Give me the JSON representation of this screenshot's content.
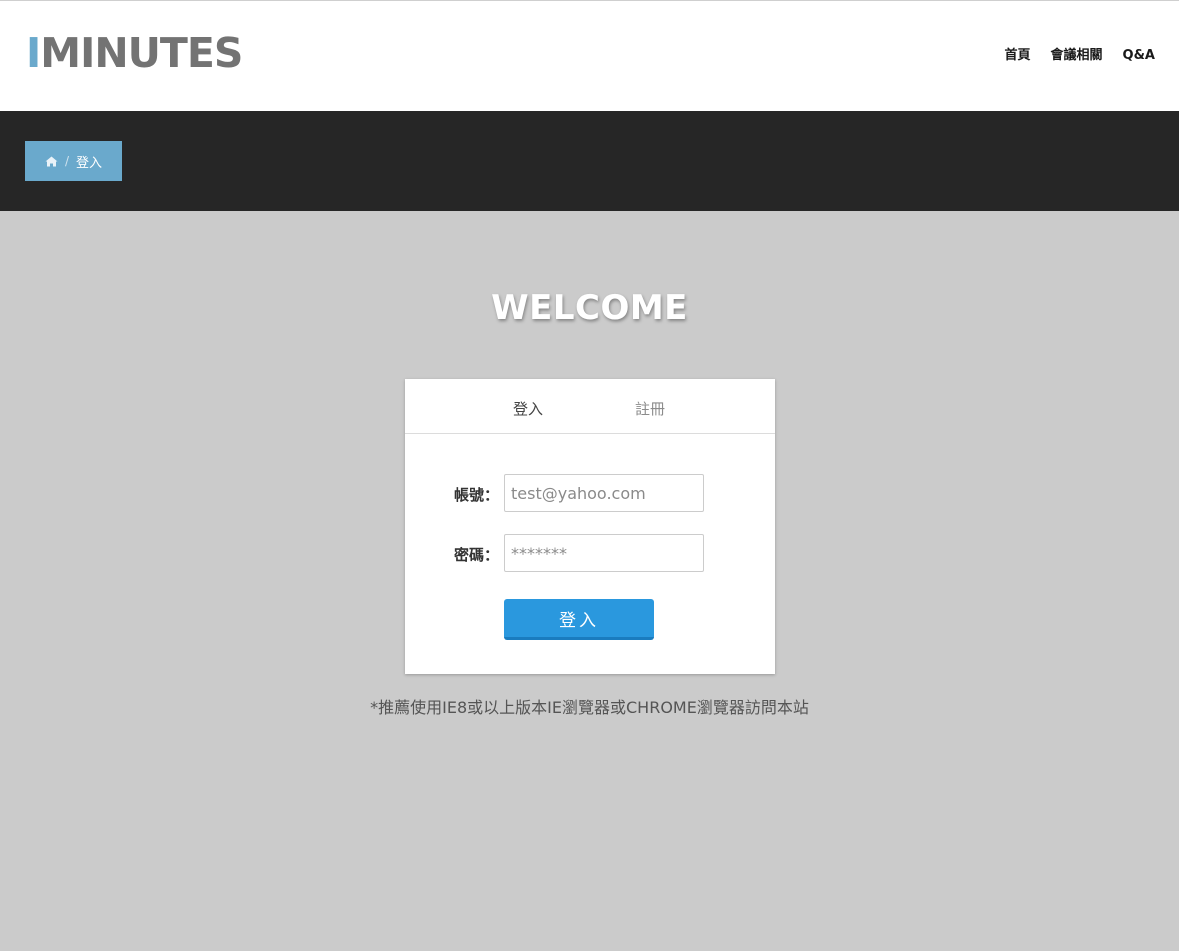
{
  "header": {
    "logo_first": "I",
    "logo_rest": "MINUTES",
    "nav": [
      {
        "label": "首頁"
      },
      {
        "label": "會議相關"
      },
      {
        "label": "Q&A"
      }
    ]
  },
  "breadcrumb": {
    "home_icon": "home-icon",
    "separator": "/",
    "current": "登入"
  },
  "welcome": "WELCOME",
  "login_card": {
    "tabs": [
      {
        "label": "登入",
        "active": true
      },
      {
        "label": "註冊",
        "active": false
      }
    ],
    "account_label": "帳號：",
    "account_placeholder": "test@yahoo.com",
    "password_label": "密碼：",
    "password_placeholder": "*******",
    "submit_label": "登入"
  },
  "browser_note": "*推薦使用IE8或以上版本IE瀏覽器或CHROME瀏覽器訪問本站",
  "colors": {
    "accent": "#6aa9cc",
    "button": "#2a98de",
    "dark_bar": "#262626",
    "page_bg": "#cbcbcb"
  }
}
